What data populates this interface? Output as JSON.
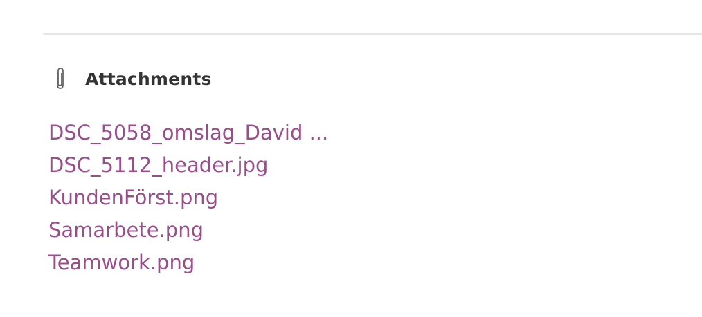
{
  "attachments_section": {
    "title": "Attachments",
    "icon": "paperclip-icon",
    "files": [
      {
        "label": "DSC_5058_omslag_David ..."
      },
      {
        "label": "DSC_5112_header.jpg"
      },
      {
        "label": "KundenFörst.png"
      },
      {
        "label": "Samarbete.png"
      },
      {
        "label": "Teamwork.png"
      }
    ]
  },
  "colors": {
    "link": "#994d8a",
    "title": "#333333",
    "divider": "#e6e6e6"
  }
}
